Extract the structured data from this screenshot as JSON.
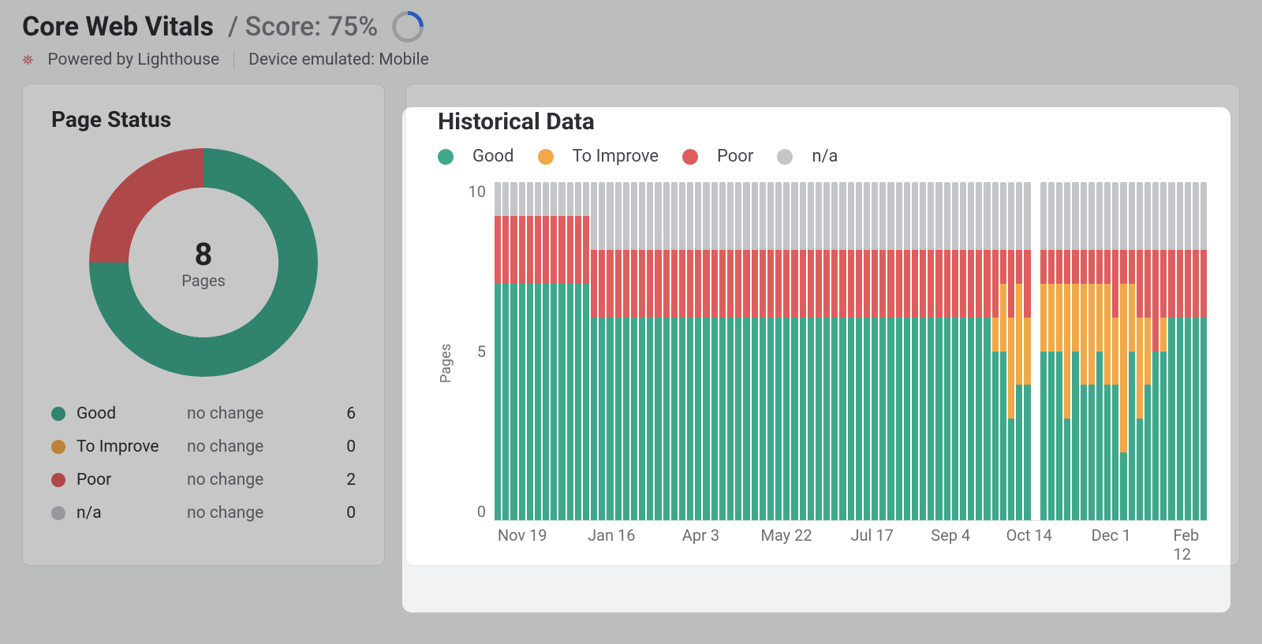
{
  "header": {
    "title": "Core Web Vitals",
    "score_prefix": "/ Score: ",
    "score_value": "75%"
  },
  "sub": {
    "powered_by": "Powered by Lighthouse",
    "device": "Device emulated: Mobile"
  },
  "page_status": {
    "title": "Page Status",
    "total": "8",
    "total_label": "Pages",
    "rows": [
      {
        "label": "Good",
        "change": "no change",
        "value": "6",
        "color": "#3ea88b"
      },
      {
        "label": "To Improve",
        "change": "no change",
        "value": "0",
        "color": "#f1a846"
      },
      {
        "label": "Poor",
        "change": "no change",
        "value": "2",
        "color": "#e05d5d"
      },
      {
        "label": "n/a",
        "change": "no change",
        "value": "0",
        "color": "#c3c5c9"
      }
    ]
  },
  "historical": {
    "title": "Historical Data",
    "legend": [
      {
        "label": "Good",
        "color": "#3ea88b"
      },
      {
        "label": "To Improve",
        "color": "#f1a846"
      },
      {
        "label": "Poor",
        "color": "#e05d5d"
      },
      {
        "label": "n/a",
        "color": "#c3c5c9"
      }
    ],
    "y_label": "Pages",
    "y_ticks": [
      "10",
      "5",
      "0"
    ],
    "x_ticks": [
      {
        "label": "Nov 19",
        "pct": 4
      },
      {
        "label": "Jan 16",
        "pct": 16.5
      },
      {
        "label": "Apr 3",
        "pct": 29
      },
      {
        "label": "May 22",
        "pct": 41
      },
      {
        "label": "Jul 17",
        "pct": 53
      },
      {
        "label": "Sep 4",
        "pct": 64
      },
      {
        "label": "Oct 14",
        "pct": 75
      },
      {
        "label": "Dec 1",
        "pct": 86.5
      },
      {
        "label": "Feb 12",
        "pct": 97
      }
    ]
  },
  "chart_data": [
    {
      "type": "pie",
      "title": "Page Status",
      "slices": [
        {
          "name": "Good",
          "value": 6,
          "color": "#3ea88b"
        },
        {
          "name": "To Improve",
          "value": 0,
          "color": "#f1a846"
        },
        {
          "name": "Poor",
          "value": 2,
          "color": "#e05d5d"
        },
        {
          "name": "n/a",
          "value": 0,
          "color": "#c3c5c9"
        }
      ],
      "total": 8
    },
    {
      "type": "bar",
      "title": "Historical Data",
      "ylabel": "Pages",
      "ylim": [
        0,
        10
      ],
      "stack_order": [
        "good",
        "improve",
        "poor",
        "na"
      ],
      "colors": {
        "good": "#3ea88b",
        "improve": "#f1a846",
        "poor": "#e05d5d",
        "na": "#c3c5c9"
      },
      "x_tick_labels": [
        "Nov 19",
        "Jan 16",
        "Apr 3",
        "May 22",
        "Jul 17",
        "Sep 4",
        "Oct 14",
        "Dec 1",
        "Feb 12"
      ],
      "points": [
        {
          "good": 7,
          "improve": 0,
          "poor": 2,
          "na": 1
        },
        {
          "good": 7,
          "improve": 0,
          "poor": 2,
          "na": 1
        },
        {
          "good": 7,
          "improve": 0,
          "poor": 2,
          "na": 1
        },
        {
          "good": 7,
          "improve": 0,
          "poor": 2,
          "na": 1
        },
        {
          "good": 7,
          "improve": 0,
          "poor": 2,
          "na": 1
        },
        {
          "good": 7,
          "improve": 0,
          "poor": 2,
          "na": 1
        },
        {
          "good": 7,
          "improve": 0,
          "poor": 2,
          "na": 1
        },
        {
          "good": 7,
          "improve": 0,
          "poor": 2,
          "na": 1
        },
        {
          "good": 7,
          "improve": 0,
          "poor": 2,
          "na": 1
        },
        {
          "good": 7,
          "improve": 0,
          "poor": 2,
          "na": 1
        },
        {
          "good": 7,
          "improve": 0,
          "poor": 2,
          "na": 1
        },
        {
          "good": 7,
          "improve": 0,
          "poor": 2,
          "na": 1
        },
        {
          "good": 6,
          "improve": 0,
          "poor": 2,
          "na": 2
        },
        {
          "good": 6,
          "improve": 0,
          "poor": 2,
          "na": 2
        },
        {
          "good": 6,
          "improve": 0,
          "poor": 2,
          "na": 2
        },
        {
          "good": 6,
          "improve": 0,
          "poor": 2,
          "na": 2
        },
        {
          "good": 6,
          "improve": 0,
          "poor": 2,
          "na": 2
        },
        {
          "good": 6,
          "improve": 0,
          "poor": 2,
          "na": 2
        },
        {
          "good": 6,
          "improve": 0,
          "poor": 2,
          "na": 2
        },
        {
          "good": 6,
          "improve": 0,
          "poor": 2,
          "na": 2
        },
        {
          "good": 6,
          "improve": 0,
          "poor": 2,
          "na": 2
        },
        {
          "good": 6,
          "improve": 0,
          "poor": 2,
          "na": 2
        },
        {
          "good": 6,
          "improve": 0,
          "poor": 2,
          "na": 2
        },
        {
          "good": 6,
          "improve": 0,
          "poor": 2,
          "na": 2
        },
        {
          "good": 6,
          "improve": 0,
          "poor": 2,
          "na": 2
        },
        {
          "good": 6,
          "improve": 0,
          "poor": 2,
          "na": 2
        },
        {
          "good": 6,
          "improve": 0,
          "poor": 2,
          "na": 2
        },
        {
          "good": 6,
          "improve": 0,
          "poor": 2,
          "na": 2
        },
        {
          "good": 6,
          "improve": 0,
          "poor": 2,
          "na": 2
        },
        {
          "good": 6,
          "improve": 0,
          "poor": 2,
          "na": 2
        },
        {
          "good": 6,
          "improve": 0,
          "poor": 2,
          "na": 2
        },
        {
          "good": 6,
          "improve": 0,
          "poor": 2,
          "na": 2
        },
        {
          "good": 6,
          "improve": 0,
          "poor": 2,
          "na": 2
        },
        {
          "good": 6,
          "improve": 0,
          "poor": 2,
          "na": 2
        },
        {
          "good": 6,
          "improve": 0,
          "poor": 2,
          "na": 2
        },
        {
          "good": 6,
          "improve": 0,
          "poor": 2,
          "na": 2
        },
        {
          "good": 6,
          "improve": 0,
          "poor": 2,
          "na": 2
        },
        {
          "good": 6,
          "improve": 0,
          "poor": 2,
          "na": 2
        },
        {
          "good": 6,
          "improve": 0,
          "poor": 2,
          "na": 2
        },
        {
          "good": 6,
          "improve": 0,
          "poor": 2,
          "na": 2
        },
        {
          "good": 6,
          "improve": 0,
          "poor": 2,
          "na": 2
        },
        {
          "good": 6,
          "improve": 0,
          "poor": 2,
          "na": 2
        },
        {
          "good": 6,
          "improve": 0,
          "poor": 2,
          "na": 2
        },
        {
          "good": 6,
          "improve": 0,
          "poor": 2,
          "na": 2
        },
        {
          "good": 6,
          "improve": 0,
          "poor": 2,
          "na": 2
        },
        {
          "good": 6,
          "improve": 0,
          "poor": 2,
          "na": 2
        },
        {
          "good": 6,
          "improve": 0,
          "poor": 2,
          "na": 2
        },
        {
          "good": 6,
          "improve": 0,
          "poor": 2,
          "na": 2
        },
        {
          "good": 6,
          "improve": 0,
          "poor": 2,
          "na": 2
        },
        {
          "good": 6,
          "improve": 0,
          "poor": 2,
          "na": 2
        },
        {
          "good": 6,
          "improve": 0,
          "poor": 2,
          "na": 2
        },
        {
          "good": 6,
          "improve": 0,
          "poor": 2,
          "na": 2
        },
        {
          "good": 6,
          "improve": 0,
          "poor": 2,
          "na": 2
        },
        {
          "good": 6,
          "improve": 0,
          "poor": 2,
          "na": 2
        },
        {
          "good": 6,
          "improve": 0,
          "poor": 2,
          "na": 2
        },
        {
          "good": 6,
          "improve": 0,
          "poor": 2,
          "na": 2
        },
        {
          "good": 6,
          "improve": 0,
          "poor": 2,
          "na": 2
        },
        {
          "good": 6,
          "improve": 0,
          "poor": 2,
          "na": 2
        },
        {
          "good": 6,
          "improve": 0,
          "poor": 2,
          "na": 2
        },
        {
          "good": 6,
          "improve": 0,
          "poor": 2,
          "na": 2
        },
        {
          "good": 6,
          "improve": 0,
          "poor": 2,
          "na": 2
        },
        {
          "good": 6,
          "improve": 0,
          "poor": 2,
          "na": 2
        },
        {
          "good": 5,
          "improve": 1,
          "poor": 2,
          "na": 2
        },
        {
          "good": 5,
          "improve": 2,
          "poor": 1,
          "na": 2
        },
        {
          "good": 3,
          "improve": 3,
          "poor": 2,
          "na": 2
        },
        {
          "good": 4,
          "improve": 3,
          "poor": 1,
          "na": 2
        },
        {
          "good": 4,
          "improve": 2,
          "poor": 2,
          "na": 2
        },
        {
          "gap": true
        },
        {
          "good": 5,
          "improve": 2,
          "poor": 1,
          "na": 2
        },
        {
          "good": 5,
          "improve": 2,
          "poor": 1,
          "na": 2
        },
        {
          "good": 5,
          "improve": 2,
          "poor": 1,
          "na": 2
        },
        {
          "good": 3,
          "improve": 4,
          "poor": 1,
          "na": 2
        },
        {
          "good": 5,
          "improve": 2,
          "poor": 1,
          "na": 2
        },
        {
          "good": 4,
          "improve": 3,
          "poor": 1,
          "na": 2
        },
        {
          "good": 4,
          "improve": 3,
          "poor": 1,
          "na": 2
        },
        {
          "good": 5,
          "improve": 2,
          "poor": 1,
          "na": 2
        },
        {
          "good": 4,
          "improve": 3,
          "poor": 1,
          "na": 2
        },
        {
          "good": 4,
          "improve": 2,
          "poor": 2,
          "na": 2
        },
        {
          "good": 2,
          "improve": 5,
          "poor": 1,
          "na": 2
        },
        {
          "good": 5,
          "improve": 2,
          "poor": 1,
          "na": 2
        },
        {
          "good": 3,
          "improve": 3,
          "poor": 2,
          "na": 2
        },
        {
          "good": 4,
          "improve": 2,
          "poor": 2,
          "na": 2
        },
        {
          "good": 5,
          "improve": 0,
          "poor": 3,
          "na": 2
        },
        {
          "good": 5,
          "improve": 1,
          "poor": 2,
          "na": 2
        },
        {
          "good": 6,
          "improve": 0,
          "poor": 2,
          "na": 2
        },
        {
          "good": 6,
          "improve": 0,
          "poor": 2,
          "na": 2
        },
        {
          "good": 6,
          "improve": 0,
          "poor": 2,
          "na": 2
        },
        {
          "good": 6,
          "improve": 0,
          "poor": 2,
          "na": 2
        },
        {
          "good": 6,
          "improve": 0,
          "poor": 2,
          "na": 2
        }
      ]
    }
  ]
}
